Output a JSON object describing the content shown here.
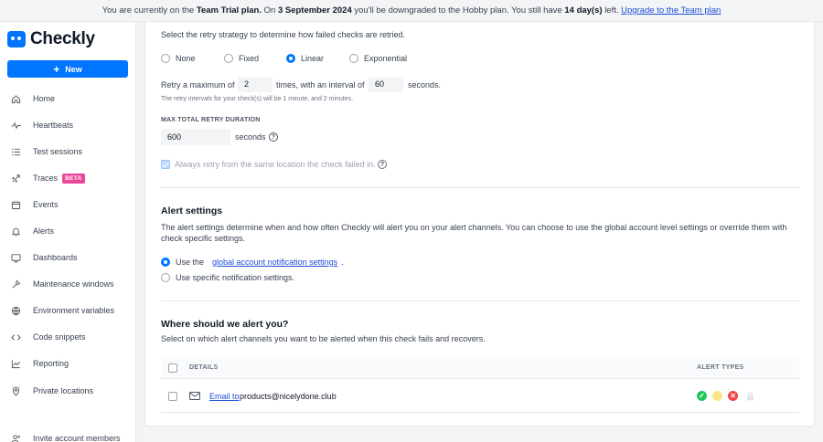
{
  "banner": {
    "text_1": "You are currently on the",
    "plan": "Team Trial plan.",
    "text_2": "On",
    "date": "3 September 2024",
    "text_3": "you'll be downgraded to the Hobby plan. You still have",
    "days": "14 day(s)",
    "text_4": "left.",
    "upgrade_link": "Upgrade to the Team plan"
  },
  "sidebar": {
    "logo": "Checkly",
    "new_button": "New",
    "items": [
      {
        "label": "Home",
        "icon": "home-icon"
      },
      {
        "label": "Heartbeats",
        "icon": "heartbeat-icon"
      },
      {
        "label": "Test sessions",
        "icon": "list-icon"
      },
      {
        "label": "Traces",
        "icon": "rocket-icon",
        "badge": "BETA"
      },
      {
        "label": "Events",
        "icon": "calendar-icon"
      },
      {
        "label": "Alerts",
        "icon": "bell-icon"
      },
      {
        "label": "Dashboards",
        "icon": "monitor-icon"
      },
      {
        "label": "Maintenance windows",
        "icon": "wrench-icon"
      },
      {
        "label": "Environment variables",
        "icon": "globe-icon"
      },
      {
        "label": "Code snippets",
        "icon": "code-icon"
      },
      {
        "label": "Reporting",
        "icon": "chart-icon"
      },
      {
        "label": "Private locations",
        "icon": "location-pin-icon"
      },
      {
        "label": "Invite account members",
        "icon": "user-plus-icon"
      }
    ]
  },
  "retry": {
    "description": "Select the retry strategy to determine how failed checks are retried.",
    "options": [
      "None",
      "Fixed",
      "Linear",
      "Exponential"
    ],
    "selected": "Linear",
    "max_label_1": "Retry a maximum of",
    "max_value": "2",
    "max_label_2": "times, with an interval of",
    "interval_value": "60",
    "interval_unit": "seconds.",
    "hint": "The retry intervals for your check(s) will be 1 minute, and 2 minutes.",
    "duration_label": "MAX TOTAL RETRY DURATION",
    "duration_value": "600",
    "duration_unit": "seconds",
    "same_location_label": "Always retry from the same location the check failed in."
  },
  "alert_settings": {
    "title": "Alert settings",
    "description_1": "The alert settings determine when and how often Checkly will alert you on your alert channels. You can choose to use the global account level settings or override them with",
    "description_2": "check specific settings.",
    "option_global_prefix": "Use the",
    "option_global_link": "global account notification settings",
    "option_global_suffix": ".",
    "option_specific": "Use specific notification settings."
  },
  "alert_channels": {
    "title": "Where should we alert you?",
    "description": "Select on which alert channels you want to be alerted when this check fails and recovers.",
    "col_details": "DETAILS",
    "col_alert_types": "ALERT TYPES",
    "rows": [
      {
        "type_link": "Email to",
        "address": "products@nicelydone.club"
      }
    ]
  },
  "colors": {
    "accent": "#0075ff",
    "success": "#22c55e",
    "degraded": "#fde68a",
    "failure": "#ef4444",
    "beta": "#ec4899"
  }
}
